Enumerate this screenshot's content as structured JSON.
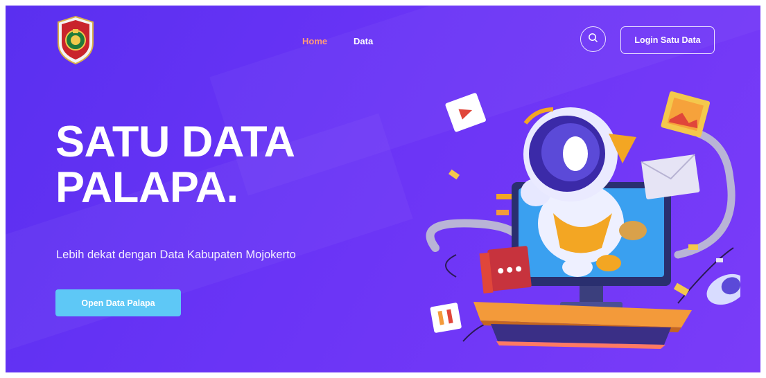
{
  "nav": {
    "links": [
      {
        "label": "Home",
        "active": true
      },
      {
        "label": "Data",
        "active": false
      }
    ],
    "search_icon": "search-icon",
    "login_label": "Login Satu Data"
  },
  "hero": {
    "title_line1": "SATU DATA",
    "title_line2": "PALAPA.",
    "subtitle": "Lebih dekat dengan Data Kabupaten Mojokerto",
    "cta_label": "Open Data Palapa"
  },
  "colors": {
    "background": "#6233f3",
    "active_link": "#ff9a7a",
    "cta": "#5ec8f6"
  },
  "illustration": {
    "subject": "robot-astronaut-computer-illustration"
  }
}
